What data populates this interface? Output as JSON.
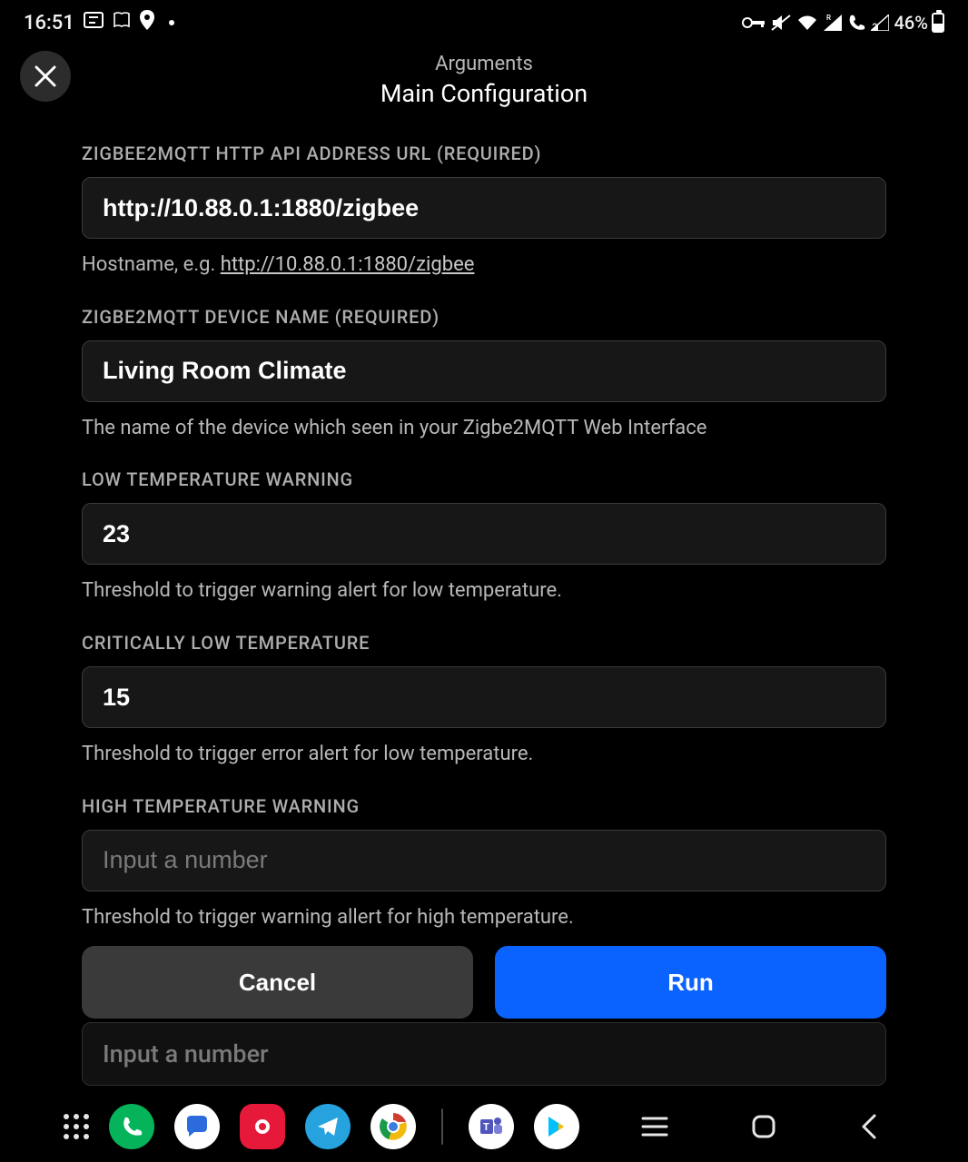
{
  "status": {
    "time": "16:51",
    "battery_pct": "46%"
  },
  "header": {
    "subtitle": "Arguments",
    "title": "Main Configuration"
  },
  "fields": {
    "api_url": {
      "label": "ZIGBEE2MQTT HTTP API ADDRESS URL (REQUIRED)",
      "value": "http://10.88.0.1:1880/zigbee",
      "help_prefix": "Hostname, e.g. ",
      "help_link": "http://10.88.0.1:1880/zigbee"
    },
    "device_name": {
      "label": "ZIGBE2MQTT DEVICE NAME (REQUIRED)",
      "value": "Living Room Climate",
      "help": "The name of the device which seen in your Zigbe2MQTT Web Interface"
    },
    "low_temp_warn": {
      "label": "LOW TEMPERATURE WARNING",
      "value": "23",
      "help": "Threshold to trigger warning alert for low temperature."
    },
    "crit_low_temp": {
      "label": "CRITICALLY LOW TEMPERATURE",
      "value": "15",
      "help": "Threshold to trigger error alert for low temperature."
    },
    "high_temp_warn": {
      "label": "HIGH TEMPERATURE WARNING",
      "placeholder": "Input a number",
      "help": "Threshold to trigger warning allert for high temperature."
    },
    "peek": {
      "placeholder": "Input a number"
    }
  },
  "buttons": {
    "cancel": "Cancel",
    "run": "Run"
  }
}
